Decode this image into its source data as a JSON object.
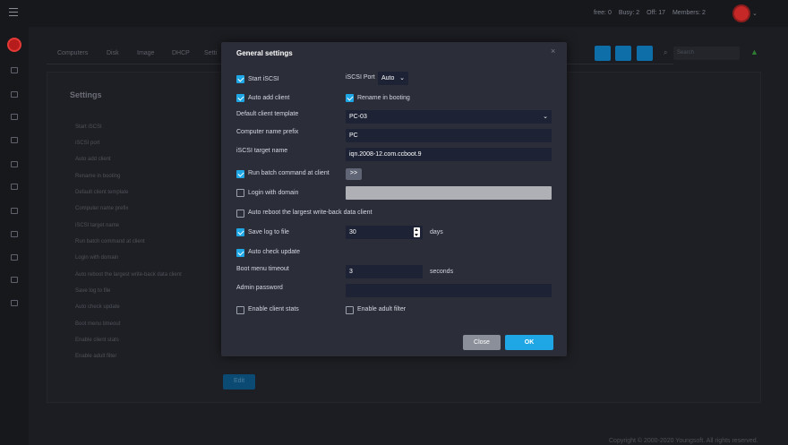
{
  "header": {
    "stats": {
      "free": "free: 0",
      "busy": "Busy: 2",
      "off": "Off: 17",
      "members": "Members: 2"
    }
  },
  "tabs": [
    "Computers",
    "Disk",
    "Image",
    "DHCP",
    "Setti"
  ],
  "toolbar": {
    "search_placeholder": "Search"
  },
  "background_settings": {
    "title": "Settings",
    "labels": [
      "Start iSCSI",
      "iSCSI port",
      "Auto add client",
      "Rename in booting",
      "Default client template",
      "Computer name prefix",
      "iSCSI target name",
      "Run batch command at client",
      "Login with domain",
      "Auto reboot the largest write-back data client",
      "Save log to file",
      "Auto check update",
      "Boot menu timeout",
      "Enable client stats",
      "Enable adult filter"
    ],
    "edit_label": "Edit"
  },
  "footer": {
    "copyright": "Copyright © 2000-2020 Youngsoft. All rights reserved."
  },
  "modal": {
    "title": "General settings",
    "close_icon": "×",
    "start_iscsi": {
      "label": "Start iSCSI",
      "checked": true
    },
    "iscsi_port": {
      "label": "iSCSI Port",
      "value": "Auto"
    },
    "auto_add_client": {
      "label": "Auto add client",
      "checked": true
    },
    "rename_in_booting": {
      "label": "Rename in booting",
      "checked": true
    },
    "default_client_template": {
      "label": "Default client template",
      "value": "PC-03"
    },
    "computer_name_prefix": {
      "label": "Computer name prefix",
      "value": "PC"
    },
    "iscsi_target_name": {
      "label": "iSCSI target name",
      "value": "iqn.2008-12.com.ccboot.9"
    },
    "run_batch_command": {
      "label": "Run batch command at client",
      "checked": true,
      "button": ">>"
    },
    "login_with_domain": {
      "label": "Login with domain",
      "checked": false,
      "value": ""
    },
    "auto_reboot": {
      "label": "Auto reboot the largest write-back data client",
      "checked": false
    },
    "save_log": {
      "label": "Save log to file",
      "checked": true,
      "value": "30",
      "unit": "days"
    },
    "auto_check_update": {
      "label": "Auto check update",
      "checked": true
    },
    "boot_menu_timeout": {
      "label": "Boot menu timeout",
      "value": "3",
      "unit": "seconds"
    },
    "admin_password": {
      "label": "Admin password",
      "value": ""
    },
    "enable_client_stats": {
      "label": "Enable client stats",
      "checked": false
    },
    "enable_adult_filter": {
      "label": "Enable adult filter",
      "checked": false
    },
    "close_button": "Close",
    "ok_button": "OK",
    "colors": {
      "accent": "#1ea7e4",
      "field_bg": "#1d2335",
      "modal_bg": "#2b2e39"
    }
  }
}
